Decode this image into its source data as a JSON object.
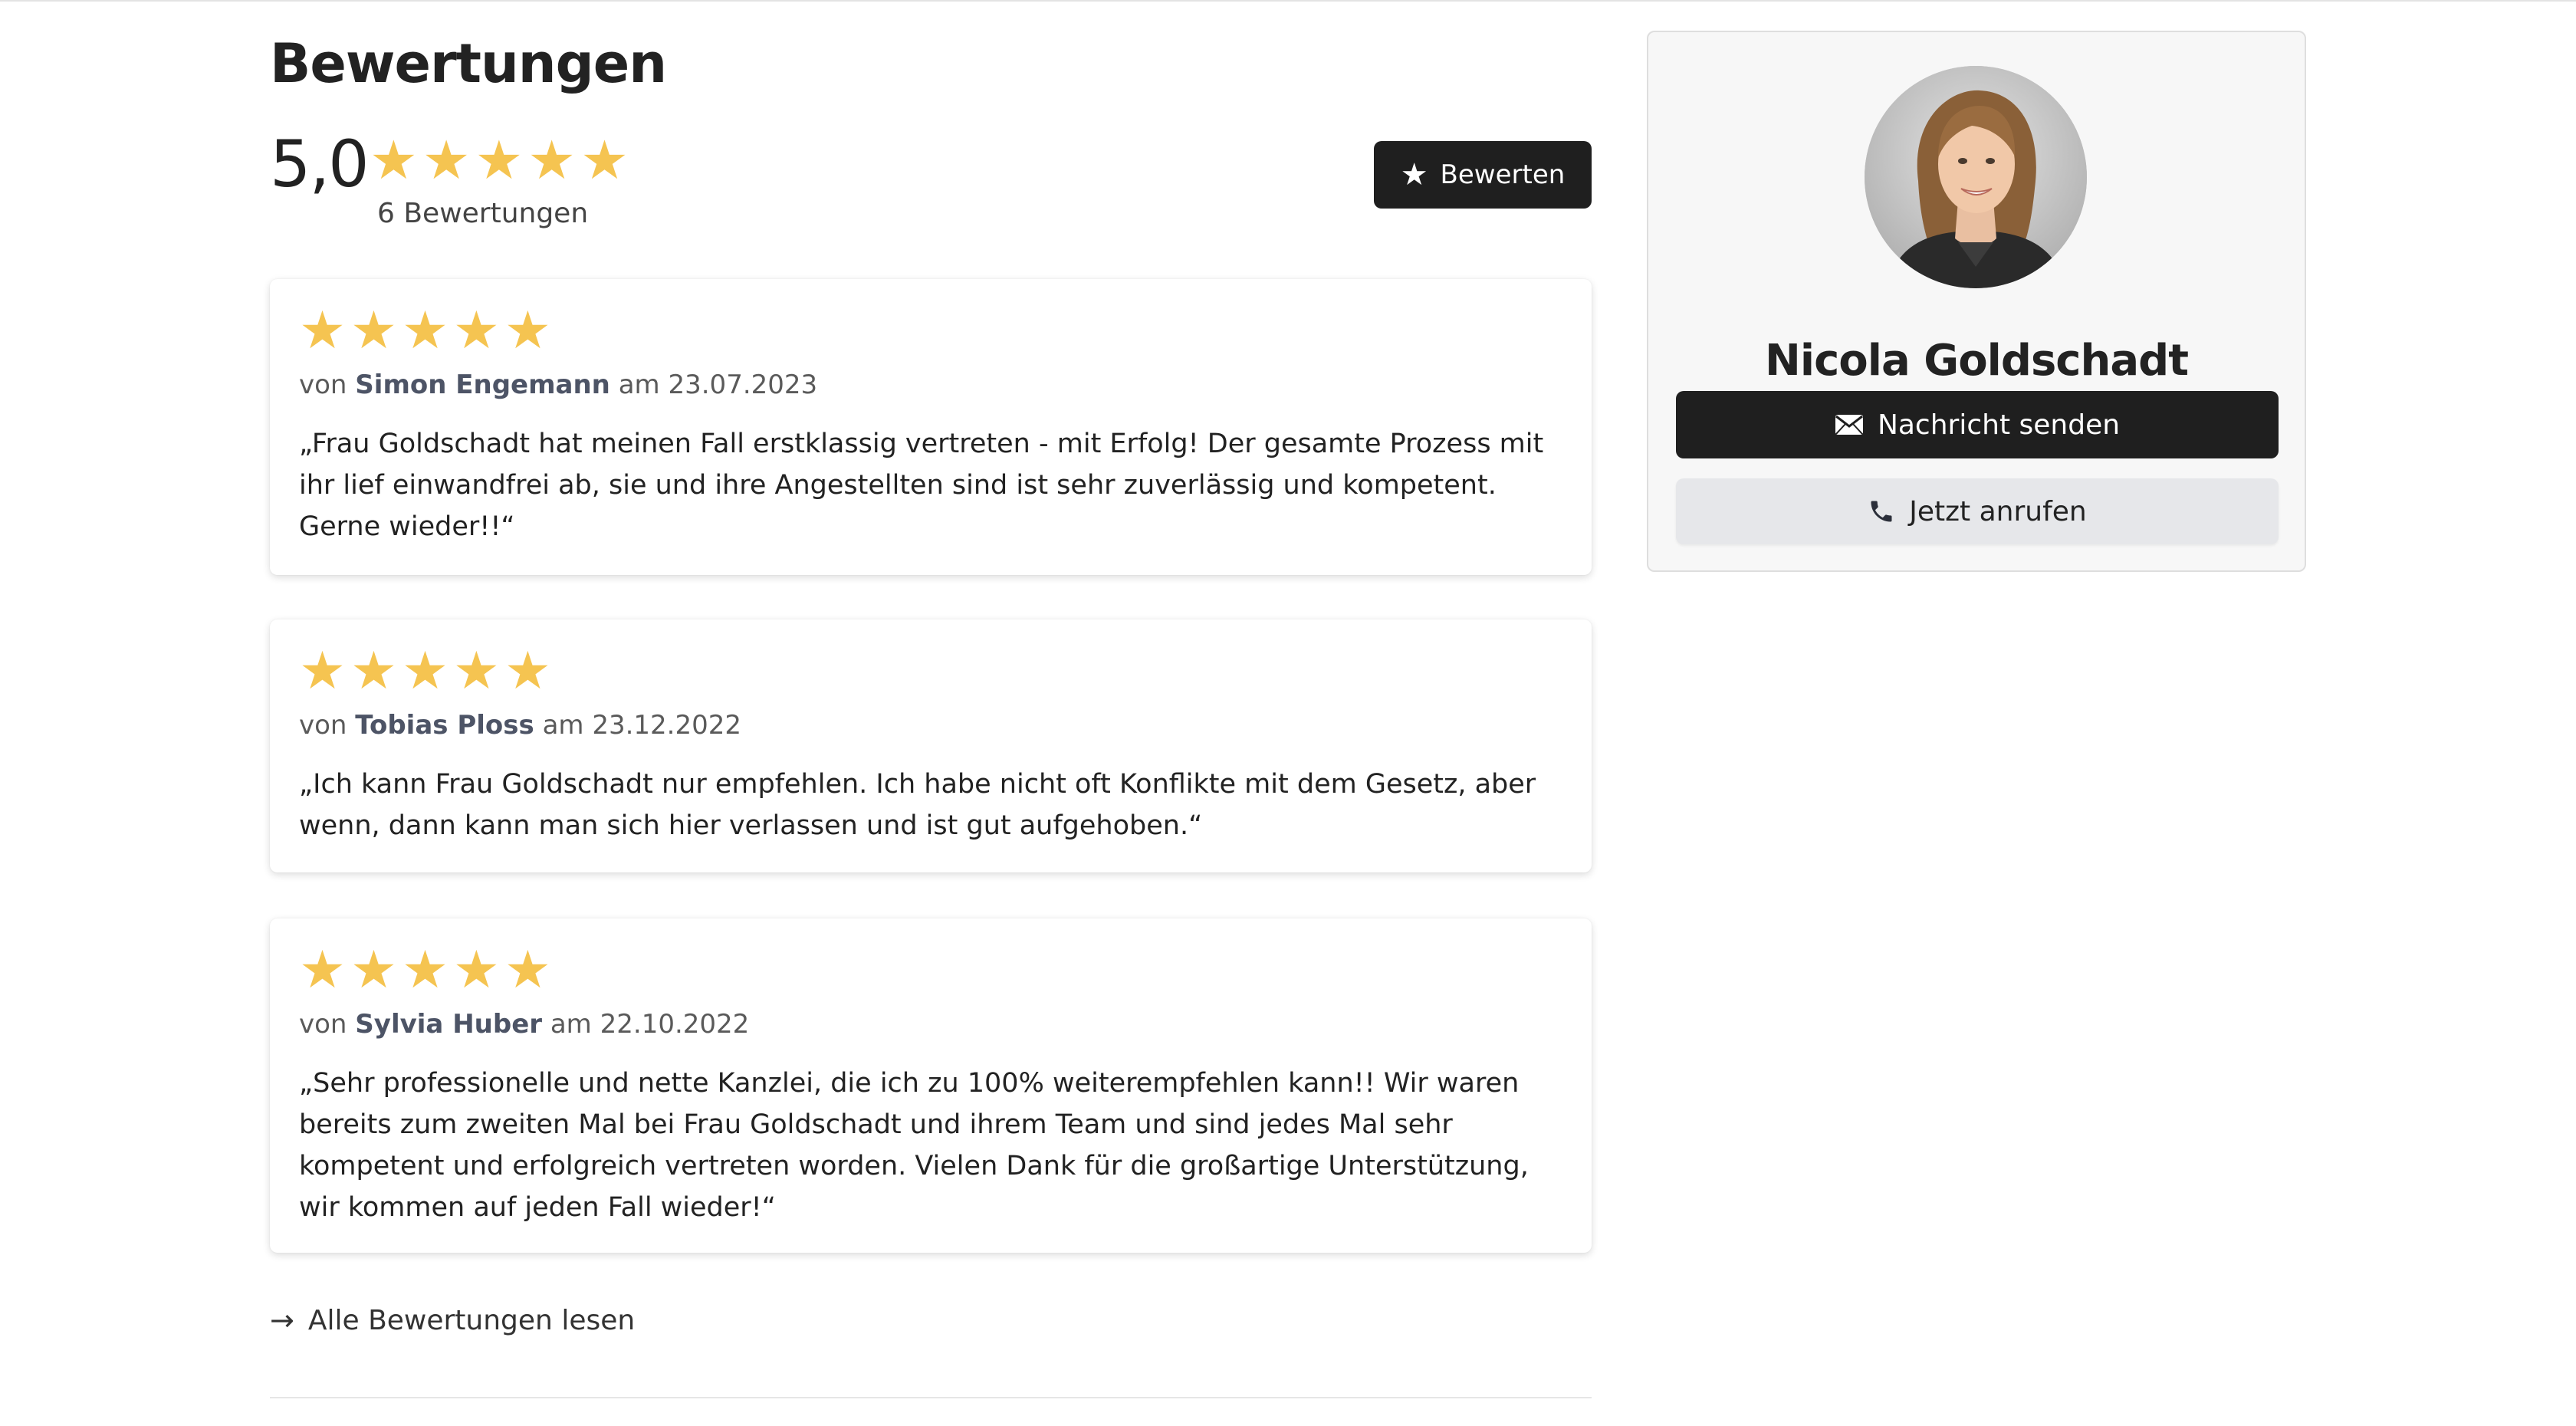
{
  "ratings": {
    "title": "Bewertungen",
    "average": "5,0",
    "average_stars": 5,
    "count_label": "6 Bewertungen",
    "rate_button_label": "Bewerten",
    "rate_button_icon": "star-icon",
    "star_color": "#f5c451",
    "all_reviews_label": "Alle Bewertungen lesen",
    "all_reviews_icon": "arrow-right-icon"
  },
  "reviews": [
    {
      "stars": 5,
      "prefix": "von",
      "author": "Simon Engemann",
      "date_prefix": "am",
      "date": "23.07.2023",
      "text": "„Frau Goldschadt hat meinen Fall erstklassig vertreten - mit Erfolg! Der gesamte Prozess mit ihr lief einwandfrei ab, sie und ihre Angestellten sind ist sehr zuverlässig und kompetent. Gerne wieder!!“"
    },
    {
      "stars": 5,
      "prefix": "von",
      "author": "Tobias Ploss",
      "date_prefix": "am",
      "date": "23.12.2022",
      "text": "„Ich kann Frau Goldschadt nur empfehlen. Ich habe nicht oft Konflikte mit dem Gesetz, aber wenn, dann kann man sich hier verlassen und ist gut aufgehoben.“"
    },
    {
      "stars": 5,
      "prefix": "von",
      "author": "Sylvia Huber",
      "date_prefix": "am",
      "date": "22.10.2022",
      "text": "„Sehr professionelle und nette Kanzlei, die ich zu 100% weiterempfehlen kann!! Wir waren bereits zum zweiten Mal bei Frau Goldschadt und ihrem Team und sind jedes Mal sehr kompetent und erfolgreich vertreten worden. Vielen Dank für die großartige Unterstützung, wir kommen auf jeden Fall wieder!“"
    }
  ],
  "profile": {
    "name": "Nicola Goldschadt",
    "message_button_label": "Nachricht senden",
    "message_button_icon": "envelope-icon",
    "call_button_label": "Jetzt anrufen",
    "call_button_icon": "phone-icon",
    "primary_color": "#1f1f1f",
    "secondary_button_color": "#e6e7ea"
  }
}
